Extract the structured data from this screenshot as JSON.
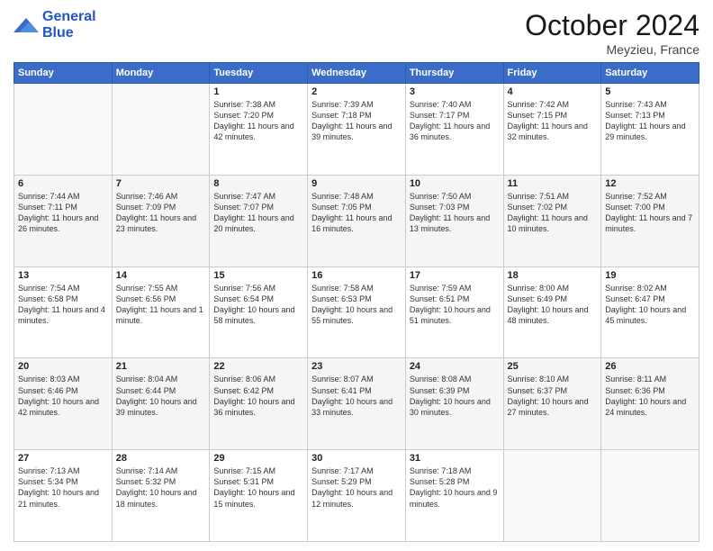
{
  "logo": {
    "line1": "General",
    "line2": "Blue"
  },
  "header": {
    "month": "October 2024",
    "location": "Meyzieu, France"
  },
  "weekdays": [
    "Sunday",
    "Monday",
    "Tuesday",
    "Wednesday",
    "Thursday",
    "Friday",
    "Saturday"
  ],
  "weeks": [
    [
      {
        "day": "",
        "sunrise": "",
        "sunset": "",
        "daylight": ""
      },
      {
        "day": "",
        "sunrise": "",
        "sunset": "",
        "daylight": ""
      },
      {
        "day": "1",
        "sunrise": "Sunrise: 7:38 AM",
        "sunset": "Sunset: 7:20 PM",
        "daylight": "Daylight: 11 hours and 42 minutes."
      },
      {
        "day": "2",
        "sunrise": "Sunrise: 7:39 AM",
        "sunset": "Sunset: 7:18 PM",
        "daylight": "Daylight: 11 hours and 39 minutes."
      },
      {
        "day": "3",
        "sunrise": "Sunrise: 7:40 AM",
        "sunset": "Sunset: 7:17 PM",
        "daylight": "Daylight: 11 hours and 36 minutes."
      },
      {
        "day": "4",
        "sunrise": "Sunrise: 7:42 AM",
        "sunset": "Sunset: 7:15 PM",
        "daylight": "Daylight: 11 hours and 32 minutes."
      },
      {
        "day": "5",
        "sunrise": "Sunrise: 7:43 AM",
        "sunset": "Sunset: 7:13 PM",
        "daylight": "Daylight: 11 hours and 29 minutes."
      }
    ],
    [
      {
        "day": "6",
        "sunrise": "Sunrise: 7:44 AM",
        "sunset": "Sunset: 7:11 PM",
        "daylight": "Daylight: 11 hours and 26 minutes."
      },
      {
        "day": "7",
        "sunrise": "Sunrise: 7:46 AM",
        "sunset": "Sunset: 7:09 PM",
        "daylight": "Daylight: 11 hours and 23 minutes."
      },
      {
        "day": "8",
        "sunrise": "Sunrise: 7:47 AM",
        "sunset": "Sunset: 7:07 PM",
        "daylight": "Daylight: 11 hours and 20 minutes."
      },
      {
        "day": "9",
        "sunrise": "Sunrise: 7:48 AM",
        "sunset": "Sunset: 7:05 PM",
        "daylight": "Daylight: 11 hours and 16 minutes."
      },
      {
        "day": "10",
        "sunrise": "Sunrise: 7:50 AM",
        "sunset": "Sunset: 7:03 PM",
        "daylight": "Daylight: 11 hours and 13 minutes."
      },
      {
        "day": "11",
        "sunrise": "Sunrise: 7:51 AM",
        "sunset": "Sunset: 7:02 PM",
        "daylight": "Daylight: 11 hours and 10 minutes."
      },
      {
        "day": "12",
        "sunrise": "Sunrise: 7:52 AM",
        "sunset": "Sunset: 7:00 PM",
        "daylight": "Daylight: 11 hours and 7 minutes."
      }
    ],
    [
      {
        "day": "13",
        "sunrise": "Sunrise: 7:54 AM",
        "sunset": "Sunset: 6:58 PM",
        "daylight": "Daylight: 11 hours and 4 minutes."
      },
      {
        "day": "14",
        "sunrise": "Sunrise: 7:55 AM",
        "sunset": "Sunset: 6:56 PM",
        "daylight": "Daylight: 11 hours and 1 minute."
      },
      {
        "day": "15",
        "sunrise": "Sunrise: 7:56 AM",
        "sunset": "Sunset: 6:54 PM",
        "daylight": "Daylight: 10 hours and 58 minutes."
      },
      {
        "day": "16",
        "sunrise": "Sunrise: 7:58 AM",
        "sunset": "Sunset: 6:53 PM",
        "daylight": "Daylight: 10 hours and 55 minutes."
      },
      {
        "day": "17",
        "sunrise": "Sunrise: 7:59 AM",
        "sunset": "Sunset: 6:51 PM",
        "daylight": "Daylight: 10 hours and 51 minutes."
      },
      {
        "day": "18",
        "sunrise": "Sunrise: 8:00 AM",
        "sunset": "Sunset: 6:49 PM",
        "daylight": "Daylight: 10 hours and 48 minutes."
      },
      {
        "day": "19",
        "sunrise": "Sunrise: 8:02 AM",
        "sunset": "Sunset: 6:47 PM",
        "daylight": "Daylight: 10 hours and 45 minutes."
      }
    ],
    [
      {
        "day": "20",
        "sunrise": "Sunrise: 8:03 AM",
        "sunset": "Sunset: 6:46 PM",
        "daylight": "Daylight: 10 hours and 42 minutes."
      },
      {
        "day": "21",
        "sunrise": "Sunrise: 8:04 AM",
        "sunset": "Sunset: 6:44 PM",
        "daylight": "Daylight: 10 hours and 39 minutes."
      },
      {
        "day": "22",
        "sunrise": "Sunrise: 8:06 AM",
        "sunset": "Sunset: 6:42 PM",
        "daylight": "Daylight: 10 hours and 36 minutes."
      },
      {
        "day": "23",
        "sunrise": "Sunrise: 8:07 AM",
        "sunset": "Sunset: 6:41 PM",
        "daylight": "Daylight: 10 hours and 33 minutes."
      },
      {
        "day": "24",
        "sunrise": "Sunrise: 8:08 AM",
        "sunset": "Sunset: 6:39 PM",
        "daylight": "Daylight: 10 hours and 30 minutes."
      },
      {
        "day": "25",
        "sunrise": "Sunrise: 8:10 AM",
        "sunset": "Sunset: 6:37 PM",
        "daylight": "Daylight: 10 hours and 27 minutes."
      },
      {
        "day": "26",
        "sunrise": "Sunrise: 8:11 AM",
        "sunset": "Sunset: 6:36 PM",
        "daylight": "Daylight: 10 hours and 24 minutes."
      }
    ],
    [
      {
        "day": "27",
        "sunrise": "Sunrise: 7:13 AM",
        "sunset": "Sunset: 5:34 PM",
        "daylight": "Daylight: 10 hours and 21 minutes."
      },
      {
        "day": "28",
        "sunrise": "Sunrise: 7:14 AM",
        "sunset": "Sunset: 5:32 PM",
        "daylight": "Daylight: 10 hours and 18 minutes."
      },
      {
        "day": "29",
        "sunrise": "Sunrise: 7:15 AM",
        "sunset": "Sunset: 5:31 PM",
        "daylight": "Daylight: 10 hours and 15 minutes."
      },
      {
        "day": "30",
        "sunrise": "Sunrise: 7:17 AM",
        "sunset": "Sunset: 5:29 PM",
        "daylight": "Daylight: 10 hours and 12 minutes."
      },
      {
        "day": "31",
        "sunrise": "Sunrise: 7:18 AM",
        "sunset": "Sunset: 5:28 PM",
        "daylight": "Daylight: 10 hours and 9 minutes."
      },
      {
        "day": "",
        "sunrise": "",
        "sunset": "",
        "daylight": ""
      },
      {
        "day": "",
        "sunrise": "",
        "sunset": "",
        "daylight": ""
      }
    ]
  ]
}
